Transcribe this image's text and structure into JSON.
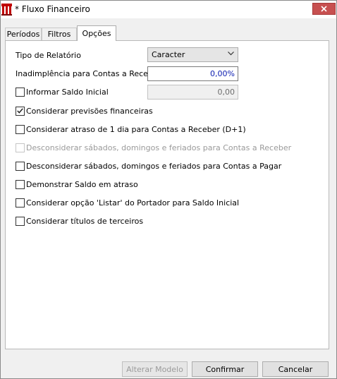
{
  "window": {
    "title": "* Fluxo Financeiro"
  },
  "tabs": [
    {
      "label": "Períodos"
    },
    {
      "label": "Filtros"
    },
    {
      "label": "Opções"
    }
  ],
  "options": {
    "tipo_relatorio": {
      "label": "Tipo de Relatório",
      "value": "Caracter"
    },
    "inadimplencia": {
      "label": "Inadimplência para Contas a Receber",
      "value": "0,00%"
    },
    "saldo_inicial": {
      "label": "Informar Saldo Inicial",
      "value": "0,00",
      "checked": false
    },
    "checkboxes": [
      {
        "label": "Considerar previsões financeiras",
        "checked": true,
        "enabled": true
      },
      {
        "label": "Considerar atraso de 1 dia para Contas a Receber (D+1)",
        "checked": false,
        "enabled": true
      },
      {
        "label": "Desconsiderar sábados, domingos e feriados para Contas a Receber",
        "checked": false,
        "enabled": false
      },
      {
        "label": "Desconsiderar sábados, domingos e feriados para Contas a Pagar",
        "checked": false,
        "enabled": true
      },
      {
        "label": "Demonstrar Saldo em atraso",
        "checked": false,
        "enabled": true
      },
      {
        "label": "Considerar opção 'Listar' do Portador para Saldo Inicial",
        "checked": false,
        "enabled": true
      },
      {
        "label": "Considerar títulos de terceiros",
        "checked": false,
        "enabled": true
      }
    ]
  },
  "buttons": {
    "alterar_modelo": "Alterar Modelo",
    "confirmar": "Confirmar",
    "cancelar": "Cancelar"
  },
  "colors": {
    "accent_blue": "#0a1bb0",
    "close_red": "#c75050",
    "brand_red": "#c00000"
  }
}
